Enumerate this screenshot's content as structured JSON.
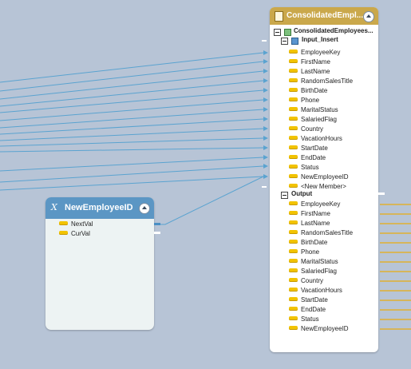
{
  "sequence": {
    "title": "NewEmployeeID",
    "fx_symbol": "X",
    "rows": [
      {
        "label": "NextVal"
      },
      {
        "label": "CurVal"
      }
    ]
  },
  "target": {
    "title": "ConsolidatedEmpl...",
    "root_label": "ConsolidatedEmployees...",
    "input_group": "Input_Insert",
    "input_fields": [
      "EmployeeKey",
      "FirstName",
      "LastName",
      "RandomSalesTitle",
      "BirthDate",
      "Phone",
      "MaritalStatus",
      "SalariedFlag",
      "Country",
      "VacationHours",
      "StartDate",
      "EndDate",
      "Status",
      "NewEmployeeID",
      "<New Member>"
    ],
    "output_group": "Output",
    "output_fields": [
      "EmployeeKey",
      "FirstName",
      "LastName",
      "RandomSalesTitle",
      "BirthDate",
      "Phone",
      "MaritalStatus",
      "SalariedFlag",
      "Country",
      "VacationHours",
      "StartDate",
      "EndDate",
      "Status",
      "NewEmployeeID"
    ]
  },
  "colors": {
    "canvas": "#b7c4d6",
    "sequence_header": "#5b96c4",
    "table_header": "#caa84b",
    "key_icon": "#f2c300",
    "wire": "#5aa3d0"
  }
}
